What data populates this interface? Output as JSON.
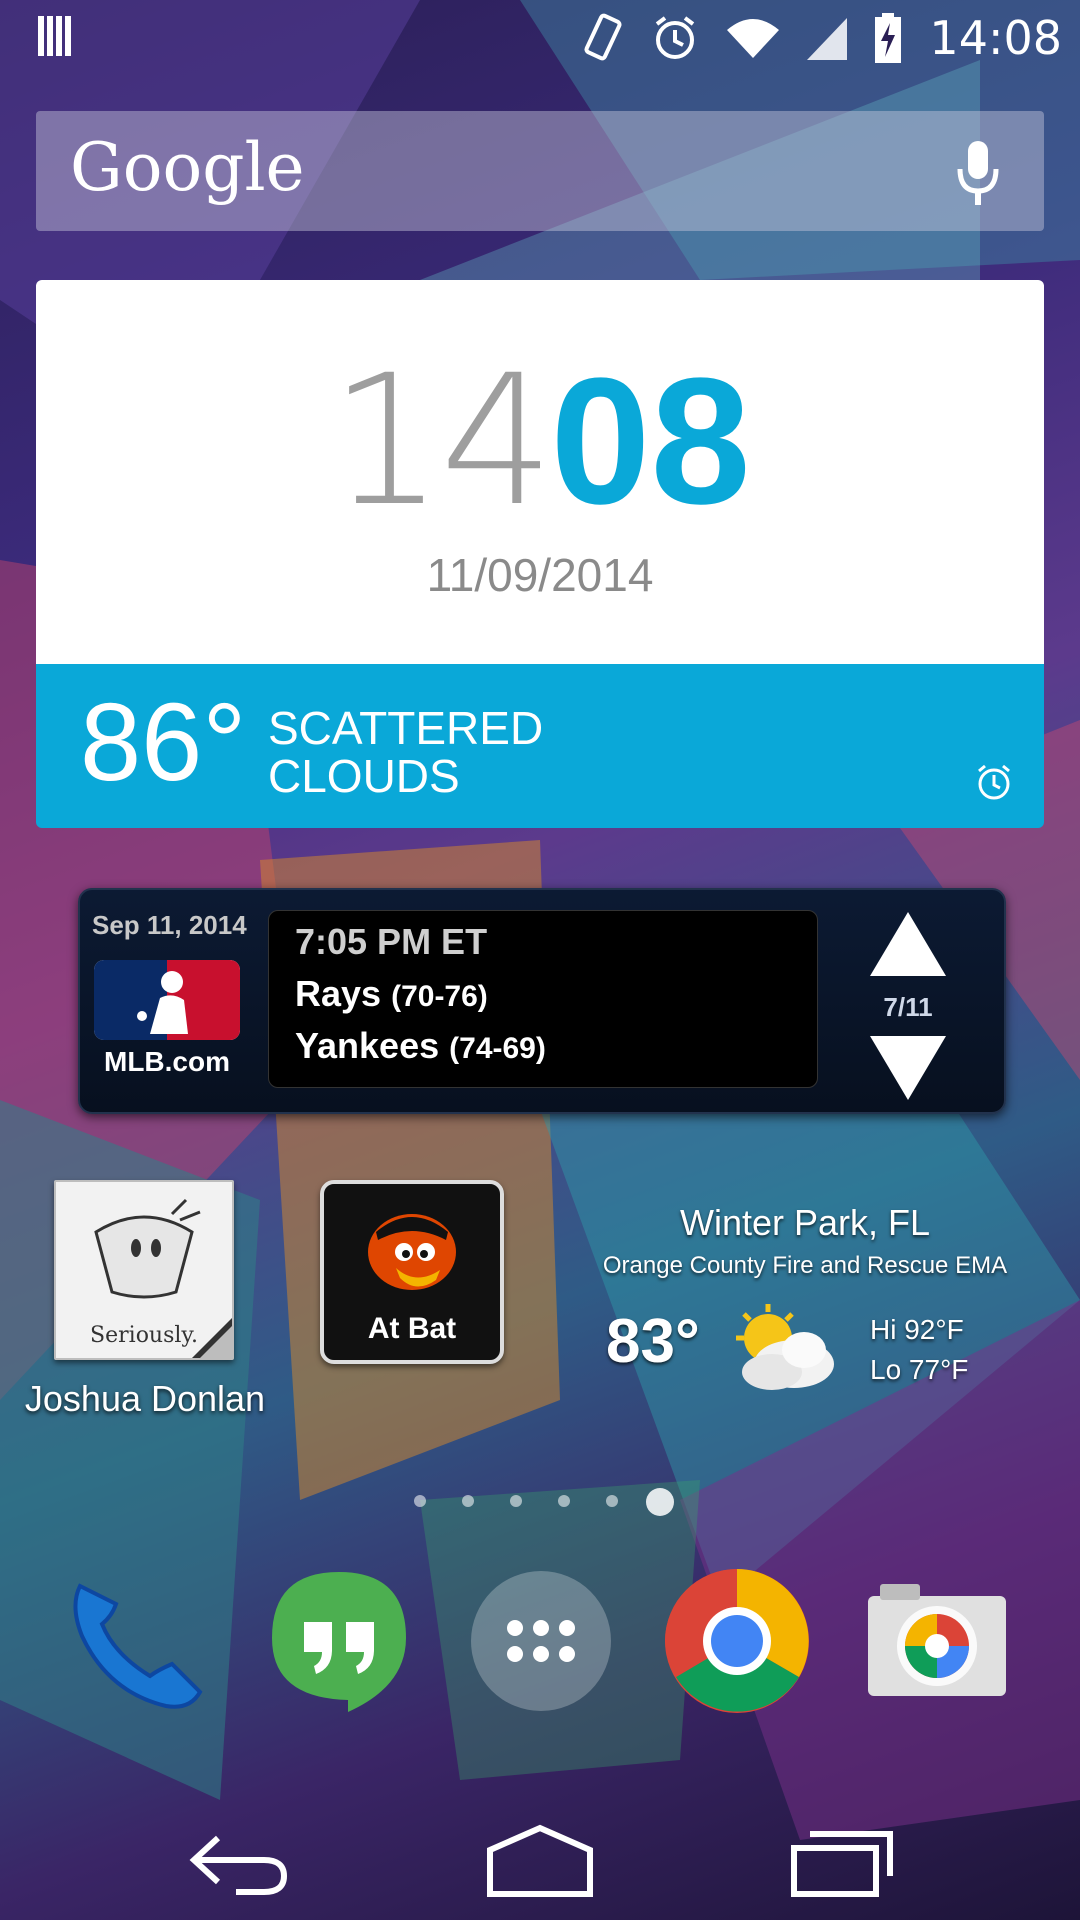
{
  "status_bar": {
    "time": "14:08",
    "icons": [
      "notification-icon",
      "vibrate-icon",
      "alarm-icon",
      "wifi-icon",
      "signal-icon",
      "battery-charging-icon"
    ]
  },
  "search": {
    "logo": "Google",
    "mic_icon": "mic-icon"
  },
  "clock_widget": {
    "hours": "14",
    "minutes": "08",
    "date": "11/09/2014",
    "temperature": "86°",
    "condition_line1": "SCATTERED",
    "condition_line2": "CLOUDS",
    "accent_color": "#0aa8d8"
  },
  "mlb_widget": {
    "date": "Sep 11, 2014",
    "logo_text": "MLB.com",
    "game_time": "7:05 PM ET",
    "team1_name": "Rays",
    "team1_record": "(70-76)",
    "team2_name": "Yankees",
    "team2_record": "(74-69)",
    "page": "7/11"
  },
  "shortcuts": [
    {
      "label": "Joshua Donlan",
      "tile_text": "Seriously."
    },
    {
      "label": "",
      "tile_text": "At Bat"
    }
  ],
  "weather_widget": {
    "city": "Winter Park, FL",
    "source": "Orange County Fire and Rescue EMA",
    "temperature": "83°",
    "hi": "Hi 92°F",
    "lo": "Lo 77°F",
    "icon": "partly-cloudy-icon"
  },
  "page_indicator": {
    "count": 6,
    "active_index": 5
  },
  "dock": [
    "phone-icon",
    "hangouts-icon",
    "app-drawer-icon",
    "chrome-icon",
    "camera-icon"
  ],
  "navigation": [
    "back-icon",
    "home-icon",
    "recents-icon"
  ]
}
